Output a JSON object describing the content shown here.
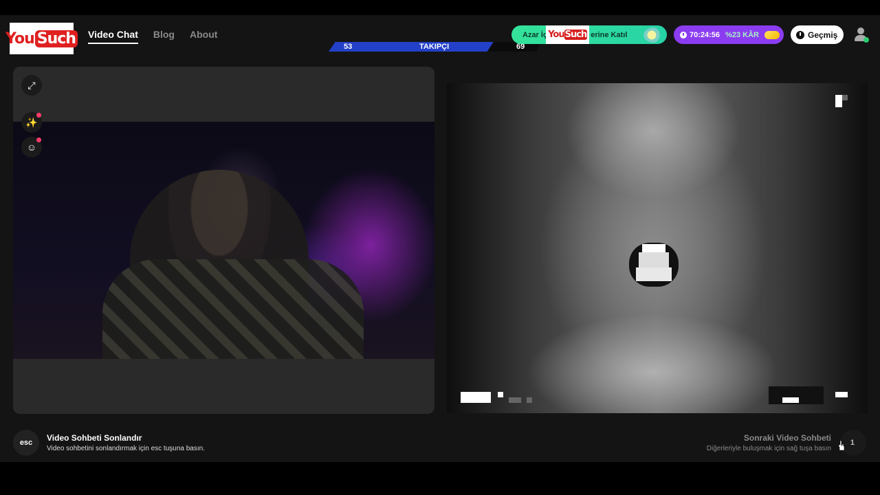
{
  "brand": {
    "logo_part1": "You",
    "logo_part2": "Such"
  },
  "nav": {
    "items": [
      {
        "label": "Video Chat",
        "active": true
      },
      {
        "label": "Blog",
        "active": false
      },
      {
        "label": "About",
        "active": false
      }
    ]
  },
  "followers": {
    "left_count": "53",
    "label": "TAKIPÇI",
    "right_count": "69"
  },
  "promo": {
    "text_before": "Azar İçe",
    "logo_part1": "You",
    "logo_part2": "Such",
    "text_after": "erine Katıl"
  },
  "timer": {
    "time": "70:24:56",
    "gain": "%23 KÂR"
  },
  "history": {
    "label": "Geçmiş"
  },
  "tools": {
    "expand_icon": "⤢",
    "magic_icon": "✨",
    "emoji_icon": "☺"
  },
  "footer": {
    "esc_key": "esc",
    "end_title": "Video Sohbeti Sonlandır",
    "end_sub": "Video sohbetini sonlandırmak için esc tuşuna basın.",
    "next_title": "Sonraki Video Sohbeti",
    "next_sub": "Diğerleriyle buluşmak için sağ tuşa basın",
    "next_key": "1"
  },
  "colors": {
    "accent_blue": "#2340c8",
    "promo_green": "#34e39a",
    "timer_purple": "#8b3cf0",
    "notification_red": "#ff3b6a"
  }
}
